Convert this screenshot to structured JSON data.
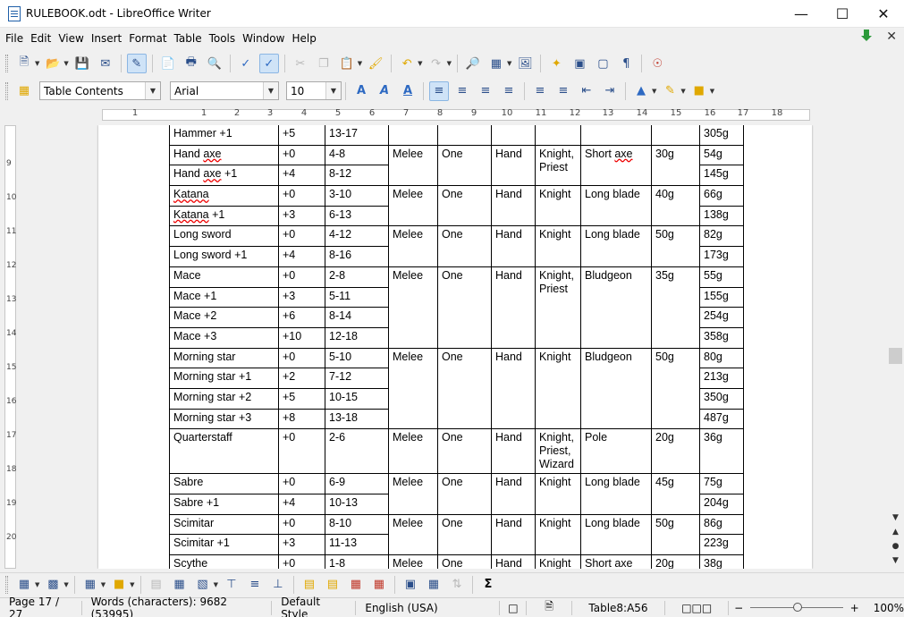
{
  "window": {
    "title": "RULEBOOK.odt - LibreOffice Writer",
    "buttons": [
      "minimize-icon",
      "maximize-icon",
      "close-icon"
    ]
  },
  "menu": [
    "File",
    "Edit",
    "View",
    "Insert",
    "Format",
    "Table",
    "Tools",
    "Window",
    "Help"
  ],
  "formatting": {
    "paragraph_style": "Table Contents",
    "font_name": "Arial",
    "font_size": "10"
  },
  "ruler": {
    "h_numbers": [
      "1",
      "1",
      "2",
      "3",
      "4",
      "5",
      "6",
      "7",
      "8",
      "9",
      "10",
      "11",
      "12",
      "13",
      "14",
      "15",
      "16",
      "17",
      "18"
    ],
    "v_numbers": [
      "9",
      "10",
      "11",
      "12",
      "13",
      "14",
      "15",
      "16",
      "17",
      "18",
      "19",
      "20"
    ]
  },
  "table": {
    "rows": [
      [
        "Hammer +1",
        "+5",
        "13-17",
        "",
        "",
        "",
        "",
        "",
        "",
        "305g"
      ],
      [
        "Hand axe",
        "+0",
        "4-8",
        "Melee",
        "One",
        "Hand",
        "Knight, Priest",
        "Short axe",
        "30g",
        "54g"
      ],
      [
        "Hand axe +1",
        "+4",
        "8-12",
        null,
        null,
        null,
        null,
        null,
        null,
        "145g"
      ],
      [
        "Katana",
        "+0",
        "3-10",
        "Melee",
        "One",
        "Hand",
        "Knight",
        "Long blade",
        "40g",
        "66g"
      ],
      [
        "Katana +1",
        "+3",
        "6-13",
        null,
        null,
        null,
        null,
        null,
        null,
        "138g"
      ],
      [
        "Long sword",
        "+0",
        "4-12",
        "Melee",
        "One",
        "Hand",
        "Knight",
        "Long blade",
        "50g",
        "82g"
      ],
      [
        "Long sword +1",
        "+4",
        "8-16",
        null,
        null,
        null,
        null,
        null,
        null,
        "173g"
      ],
      [
        "Mace",
        "+0",
        "2-8",
        "Melee",
        "One",
        "Hand",
        "Knight, Priest",
        "Bludgeon",
        "35g",
        "55g"
      ],
      [
        "Mace +1",
        "+3",
        "5-11",
        null,
        null,
        null,
        null,
        null,
        null,
        "155g"
      ],
      [
        "Mace +2",
        "+6",
        "8-14",
        null,
        null,
        null,
        null,
        null,
        null,
        "254g"
      ],
      [
        "Mace +3",
        "+10",
        "12-18",
        null,
        null,
        null,
        null,
        null,
        null,
        "358g"
      ],
      [
        "Morning star",
        "+0",
        "5-10",
        "Melee",
        "One",
        "Hand",
        "Knight",
        "Bludgeon",
        "50g",
        "80g"
      ],
      [
        "Morning star +1",
        "+2",
        "7-12",
        null,
        null,
        null,
        null,
        null,
        null,
        "213g"
      ],
      [
        "Morning star +2",
        "+5",
        "10-15",
        null,
        null,
        null,
        null,
        null,
        null,
        "350g"
      ],
      [
        "Morning star +3",
        "+8",
        "13-18",
        null,
        null,
        null,
        null,
        null,
        null,
        "487g"
      ],
      [
        "Quarterstaff",
        "+0",
        "2-6",
        "Melee",
        "One",
        "Hand",
        "Knight, Priest, Wizard",
        "Pole",
        "20g",
        "36g"
      ],
      [
        "Sabre",
        "+0",
        "6-9",
        "Melee",
        "One",
        "Hand",
        "Knight",
        "Long blade",
        "45g",
        "75g"
      ],
      [
        "Sabre +1",
        "+4",
        "10-13",
        null,
        null,
        null,
        null,
        null,
        null,
        "204g"
      ],
      [
        "Scimitar",
        "+0",
        "8-10",
        "Melee",
        "One",
        "Hand",
        "Knight",
        "Long blade",
        "50g",
        "86g"
      ],
      [
        "Scimitar +1",
        "+3",
        "11-13",
        null,
        null,
        null,
        null,
        null,
        null,
        "223g"
      ],
      [
        "Scythe",
        "+0",
        "1-8",
        "Melee",
        "One",
        "Hand",
        "Knight",
        "Short axe",
        "20g",
        "38g"
      ]
    ],
    "spell_marked": [
      "axe",
      "Katana"
    ]
  },
  "status": {
    "page": "Page 17 / 27",
    "words": "Words (characters): 9682 (53995)",
    "style": "Default Style",
    "language": "English (USA)",
    "cell": "Table8:A56",
    "zoom": "100%"
  }
}
